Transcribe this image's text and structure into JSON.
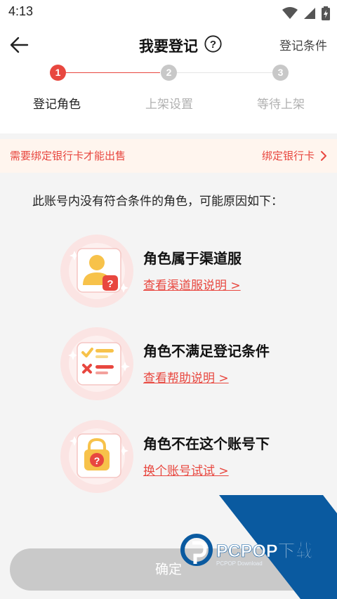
{
  "status_bar": {
    "time": "4:13"
  },
  "header": {
    "title": "我要登记",
    "conditions_label": "登记条件"
  },
  "stepper": {
    "steps": [
      {
        "number": "1",
        "label": "登记角色"
      },
      {
        "number": "2",
        "label": "上架设置"
      },
      {
        "number": "3",
        "label": "等待上架"
      }
    ],
    "active_color": "#e8473f",
    "inactive_color": "#c8c8c8"
  },
  "notice": {
    "text": "需要绑定银行卡才能出售",
    "link_label": "绑定银行卡"
  },
  "intro": "此账号内没有符合条件的角色，可能原因如下：",
  "reasons": [
    {
      "title": "角色属于渠道服",
      "link": "查看渠道服说明 >",
      "icon": "user-question-icon"
    },
    {
      "title": "角色不满足登记条件",
      "link": "查看帮助说明 >",
      "icon": "checklist-icon"
    },
    {
      "title": "角色不在这个账号下",
      "link": "换个账号试试 >",
      "icon": "lock-question-icon"
    }
  ],
  "confirm_label": "确定",
  "watermark": {
    "brand": "PCPOP下载",
    "sub": "PCPOP Download"
  },
  "colors": {
    "accent": "#e8473f",
    "notice_bg": "#fff5ee",
    "button_disabled": "#c9c9c9",
    "watermark_blue": "#0a5aa0"
  }
}
